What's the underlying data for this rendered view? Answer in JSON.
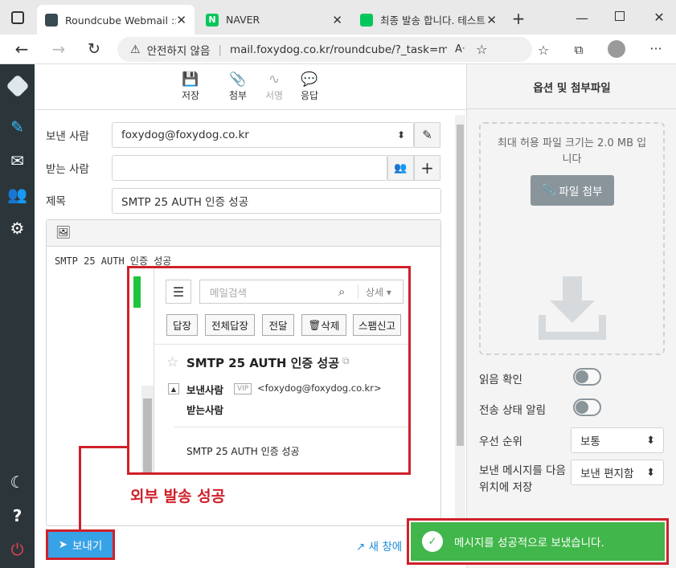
{
  "browser": {
    "tabs": [
      {
        "title": "Roundcube Webmail :: 새"
      },
      {
        "title": "NAVER"
      },
      {
        "title": "최종 발송 합니다. 테스트"
      }
    ],
    "security_label": "안전하지 않음",
    "url": "mail.foxydog.co.kr/roundcube/?_task=mai..."
  },
  "toolbar": {
    "save": "저장",
    "attach": "첨부",
    "signature": "서명",
    "responses": "응답"
  },
  "compose": {
    "from_label": "보낸 사람",
    "from_value": "foxydog@foxydog.co.kr",
    "to_label": "받는 사람",
    "to_value": "",
    "subject_label": "제목",
    "subject_value": "SMTP 25 AUTH 인증 성공",
    "body_text": "SMTP 25 AUTH 인증 성공",
    "send_label": "보내기",
    "new_window_label": "새 창에"
  },
  "options": {
    "title": "옵션 및 첨부파일",
    "max_size_text": "최대 허용 파일 크기는 2.0 MB 입니다",
    "attach_button": "파일 첨부",
    "read_receipt": "읽음 확인",
    "delivery_status": "전송 상태 알림",
    "priority_label": "우선 순위",
    "priority_value": "보통",
    "save_sent_label": "보낸 메시지를 다음 위치에 저장",
    "save_sent_value": "보낸 편지함"
  },
  "naver_overlay": {
    "search_placeholder": "메일검색",
    "detail": "상세",
    "actions": [
      "답장",
      "전체답장",
      "전달",
      "삭제",
      "스팸신고"
    ],
    "subject": "SMTP 25 AUTH 인증 성공",
    "from_label": "보낸사람",
    "vip": "VIP",
    "from_addr": "<foxydog@foxydog.co.kr>",
    "to_label": "받는사람",
    "body": "SMTP 25 AUTH 인증 성공"
  },
  "annotation": {
    "text": "외부 발송 성공",
    "color": "#d0202a"
  },
  "toast": {
    "text": "메시지를 성공적으로 보냈습니다.",
    "color": "#41b64a"
  },
  "colors": {
    "accent": "#37beff",
    "sidebar": "#2c363a",
    "send_button": "#37a2e6"
  }
}
